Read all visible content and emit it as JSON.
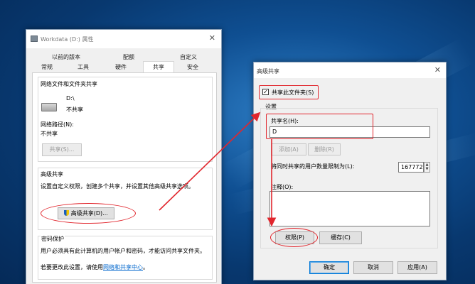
{
  "main_dialog": {
    "title": "Workdata (D:) 属性",
    "close": "✕",
    "tabs_row1": [
      "以前的版本",
      "配额",
      "自定义"
    ],
    "tabs_row2": [
      "常规",
      "工具",
      "硬件",
      "共享",
      "安全"
    ],
    "active_tab": "共享",
    "network_section": {
      "header": "网络文件和文件夹共享",
      "drive_name": "D:\\",
      "status": "不共享",
      "path_label": "网络路径(N):",
      "path_value": "不共享",
      "share_button": "共享(S)..."
    },
    "advanced_section": {
      "header": "高级共享",
      "description": "设置自定义权限，创建多个共享，并设置其他高级共享选项。",
      "button": "高级共享(D)..."
    },
    "password_section": {
      "header": "密码保护",
      "description": "用户必须具有此计算机的用户帐户和密码，才能访问共享文件夹。",
      "change_prefix": "若要更改此设置，请使用",
      "change_link": "网络和共享中心",
      "change_suffix": "。"
    }
  },
  "advanced_dialog": {
    "title": "高级共享",
    "close": "✕",
    "share_checkbox_label": "共享此文件夹(S)",
    "share_checkbox_checked": true,
    "settings_label": "设置",
    "share_name_label": "共享名(H):",
    "share_name_value": "D",
    "add_button": "添加(A)",
    "remove_button": "删除(R)",
    "user_limit_label": "将同时共享的用户数量限制为(L):",
    "user_limit_value": "167772",
    "comment_label": "注释(O):",
    "comment_value": "",
    "permissions_button": "权限(P)",
    "cache_button": "缓存(C)",
    "ok_button": "确定",
    "cancel_button": "取消",
    "apply_button": "应用(A)"
  },
  "colors": {
    "accent_red": "#e1262d",
    "link_blue": "#0066cc",
    "desktop_blue": "#0f4f92"
  }
}
